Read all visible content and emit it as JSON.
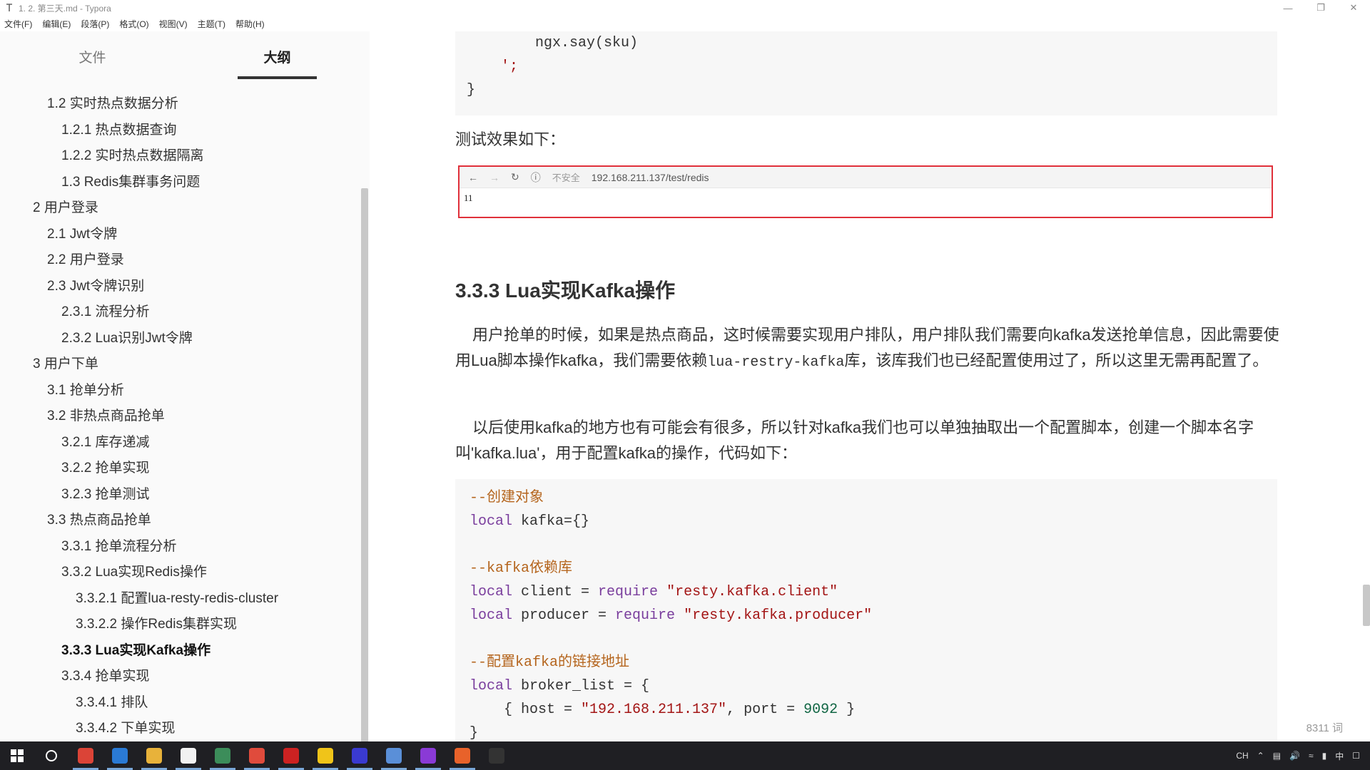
{
  "window": {
    "title": "1. 2. 第三天.md - Typora"
  },
  "menu": [
    "文件(F)",
    "编辑(E)",
    "段落(P)",
    "格式(O)",
    "视图(V)",
    "主题(T)",
    "帮助(H)"
  ],
  "sidebar": {
    "tabs": [
      {
        "label": "文件"
      },
      {
        "label": "大纲"
      }
    ],
    "outline": [
      {
        "label": "1.2 实时热点数据分析",
        "level": 2
      },
      {
        "label": "1.2.1 热点数据查询",
        "level": 3
      },
      {
        "label": "1.2.2 实时热点数据隔离",
        "level": 3
      },
      {
        "label": "1.3 Redis集群事务问题",
        "level": 3
      },
      {
        "label": "2 用户登录",
        "level": 1
      },
      {
        "label": "2.1 Jwt令牌",
        "level": 2
      },
      {
        "label": "2.2 用户登录",
        "level": 2
      },
      {
        "label": "2.3 Jwt令牌识别",
        "level": 2
      },
      {
        "label": "2.3.1 流程分析",
        "level": 3
      },
      {
        "label": "2.3.2 Lua识别Jwt令牌",
        "level": 3
      },
      {
        "label": "3 用户下单",
        "level": 1
      },
      {
        "label": "3.1 抢单分析",
        "level": 2
      },
      {
        "label": "3.2 非热点商品抢单",
        "level": 2
      },
      {
        "label": "3.2.1 库存递减",
        "level": 3
      },
      {
        "label": "3.2.2 抢单实现",
        "level": 3
      },
      {
        "label": "3.2.3 抢单测试",
        "level": 3
      },
      {
        "label": "3.3 热点商品抢单",
        "level": 2
      },
      {
        "label": "3.3.1 抢单流程分析",
        "level": 3
      },
      {
        "label": "3.3.2 Lua实现Redis操作",
        "level": 3
      },
      {
        "label": "3.3.2.1 配置lua-resty-redis-cluster",
        "level": 4
      },
      {
        "label": "3.3.2.2 操作Redis集群实现",
        "level": 4
      },
      {
        "label": "3.3.3 Lua实现Kafka操作",
        "level": 3,
        "active": true
      },
      {
        "label": "3.3.4 抢单实现",
        "level": 3
      },
      {
        "label": "3.3.4.1 排队",
        "level": 4
      },
      {
        "label": "3.3.4.2 下单实现",
        "level": 4
      }
    ]
  },
  "editor": {
    "top_code": [
      "        ngx.say(sku)",
      "    ';",
      "}"
    ],
    "test_label": "测试效果如下：",
    "browser": {
      "insecure": "不安全",
      "url": "192.168.211.137/test/redis",
      "content": "11"
    },
    "heading": "3.3.3 Lua实现Kafka操作",
    "para1_a": "用户抢单的时候，如果是热点商品，这时候需要实现用户排队，用户排队我们需要向kafka发送抢单信息，因此需要使用Lua脚本操作kafka，我们需要依赖",
    "para1_code": "lua-restry-kafka",
    "para1_b": "库，该库我们也已经配置使用过了，所以这里无需再配置了。",
    "para2": "以后使用kafka的地方也有可能会有很多，所以针对kafka我们也可以单独抽取出一个配置脚本，创建一个脚本名字叫'kafka.lua'，用于配置kafka的操作，代码如下：",
    "code": {
      "c1": "--创建对象",
      "l1_kw": "local",
      "l1_rest": " kafka={}",
      "c2": "--kafka依赖库",
      "l2_kw": "local",
      "l2_a": " client = ",
      "l2_req": "require",
      "l2_str": "\"resty.kafka.client\"",
      "l3_kw": "local",
      "l3_a": " producer = ",
      "l3_req": "require",
      "l3_str": "\"resty.kafka.producer\"",
      "c3": "--配置kafka的链接地址",
      "l4_kw": "local",
      "l4_a": " broker_list = {",
      "l5_a": "    { host = ",
      "l5_str": "\"192.168.211.137\"",
      "l5_b": ", port = ",
      "l5_num": "9092",
      "l5_c": " }",
      "l6": "}"
    },
    "word_count": "8311 词"
  },
  "taskbar": {
    "apps": [
      {
        "name": "search",
        "color": "#1f1f23"
      },
      {
        "name": "chrome",
        "color": "#db4437"
      },
      {
        "name": "explorer-blue",
        "color": "#2a7ad5"
      },
      {
        "name": "file-explorer",
        "color": "#e8b23a"
      },
      {
        "name": "notes",
        "color": "#f2f2f2"
      },
      {
        "name": "screen-tool",
        "color": "#3c8d5a"
      },
      {
        "name": "red-tool",
        "color": "#e04b3c"
      },
      {
        "name": "ruby-app",
        "color": "#cc2222"
      },
      {
        "name": "yellow-app",
        "color": "#f0c419"
      },
      {
        "name": "intellij",
        "color": "#3a3ad0"
      },
      {
        "name": "window-app",
        "color": "#5a8fd8"
      },
      {
        "name": "purple-app",
        "color": "#8a3ad6"
      },
      {
        "name": "orange-app",
        "color": "#e8622a"
      },
      {
        "name": "terminal",
        "color": "#333333"
      }
    ],
    "tray": {
      "lang": "中",
      "ime": "CH"
    }
  }
}
